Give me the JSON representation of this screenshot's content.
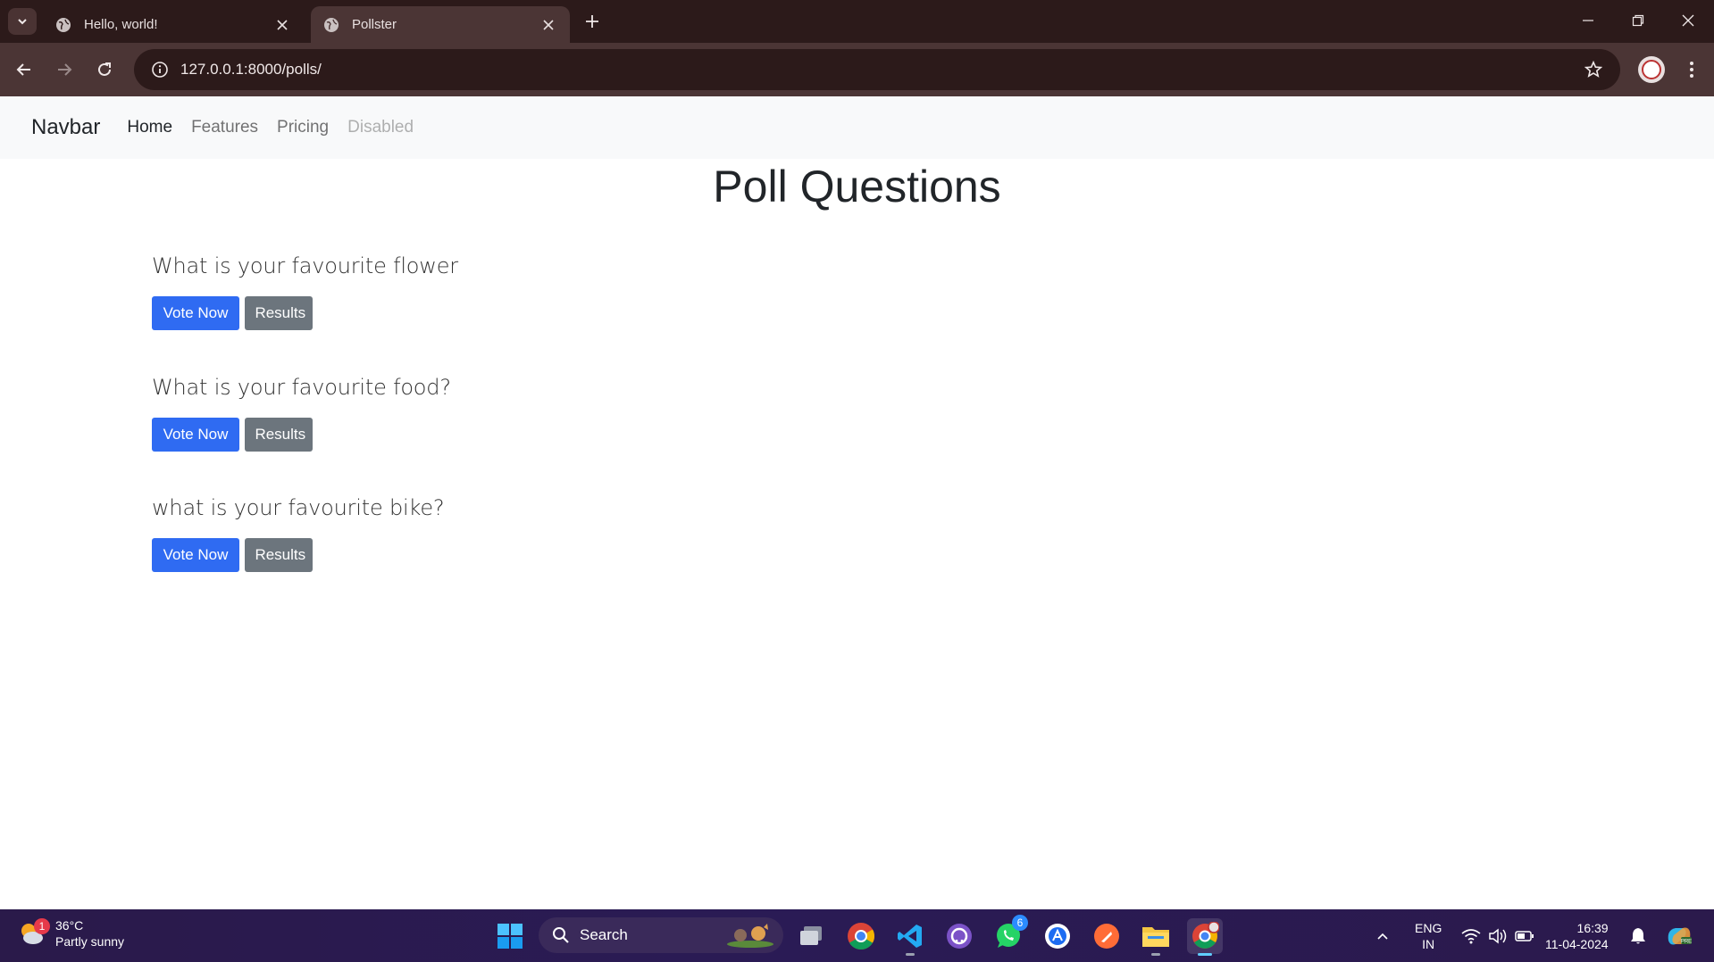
{
  "browser": {
    "tabs": [
      {
        "title": "Hello, world!",
        "active": false
      },
      {
        "title": "Pollster",
        "active": true
      }
    ],
    "url": "127.0.0.1:8000/polls/"
  },
  "navbar": {
    "brand": "Navbar",
    "links": [
      {
        "label": "Home",
        "state": "active"
      },
      {
        "label": "Features",
        "state": "normal"
      },
      {
        "label": "Pricing",
        "state": "normal"
      },
      {
        "label": "Disabled",
        "state": "disabled"
      }
    ]
  },
  "main": {
    "title": "Poll Questions",
    "questions": [
      {
        "text": "What is your favourite flower",
        "vote_label": "Vote Now",
        "results_label": "Results"
      },
      {
        "text": "What is your favourite food?",
        "vote_label": "Vote Now",
        "results_label": "Results"
      },
      {
        "text": "what is your favourite bike?",
        "vote_label": "Vote Now",
        "results_label": "Results"
      }
    ]
  },
  "taskbar": {
    "weather": {
      "temp": "36°C",
      "condition": "Partly sunny",
      "badge": "1"
    },
    "search_label": "Search",
    "apps": [
      "file-explorer-mini",
      "chrome",
      "vscode",
      "github-desktop",
      "whatsapp",
      "app-store",
      "postman",
      "file-explorer",
      "chrome-profile"
    ],
    "whatsapp_badge": "6",
    "lang": {
      "line1": "ENG",
      "line2": "IN"
    },
    "clock": {
      "time": "16:39",
      "date": "11-04-2024"
    }
  },
  "colors": {
    "primary": "#2f6bf2",
    "secondary": "#6c757d",
    "chrome_frame": "#2c1a1a",
    "chrome_toolbar": "#4b3535",
    "taskbar": "#2a1b55"
  }
}
